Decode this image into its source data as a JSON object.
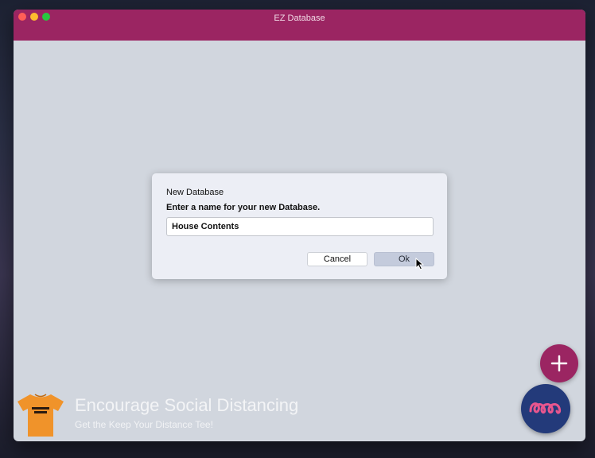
{
  "window": {
    "title": "EZ Database"
  },
  "dialog": {
    "title": "New Database",
    "message": "Enter a name for your new Database.",
    "input_value": "House Contents",
    "cancel_label": "Cancel",
    "ok_label": "Ok"
  },
  "ad": {
    "shirt_text": "KEEP YOUR DISTANCE",
    "heading": "Encourage Social Distancing",
    "subheading": "Get the Keep Your Distance Tee!"
  },
  "icons": {
    "add_button": "plus-icon",
    "app_button": "loops-logo-icon",
    "cursor": "pointer-cursor-icon"
  },
  "colors": {
    "accent": "#9b2562",
    "window_background": "#d1d6de",
    "dialog_background": "#eceef5",
    "app_button": "#233a7a",
    "shirt": "#f0932a"
  }
}
